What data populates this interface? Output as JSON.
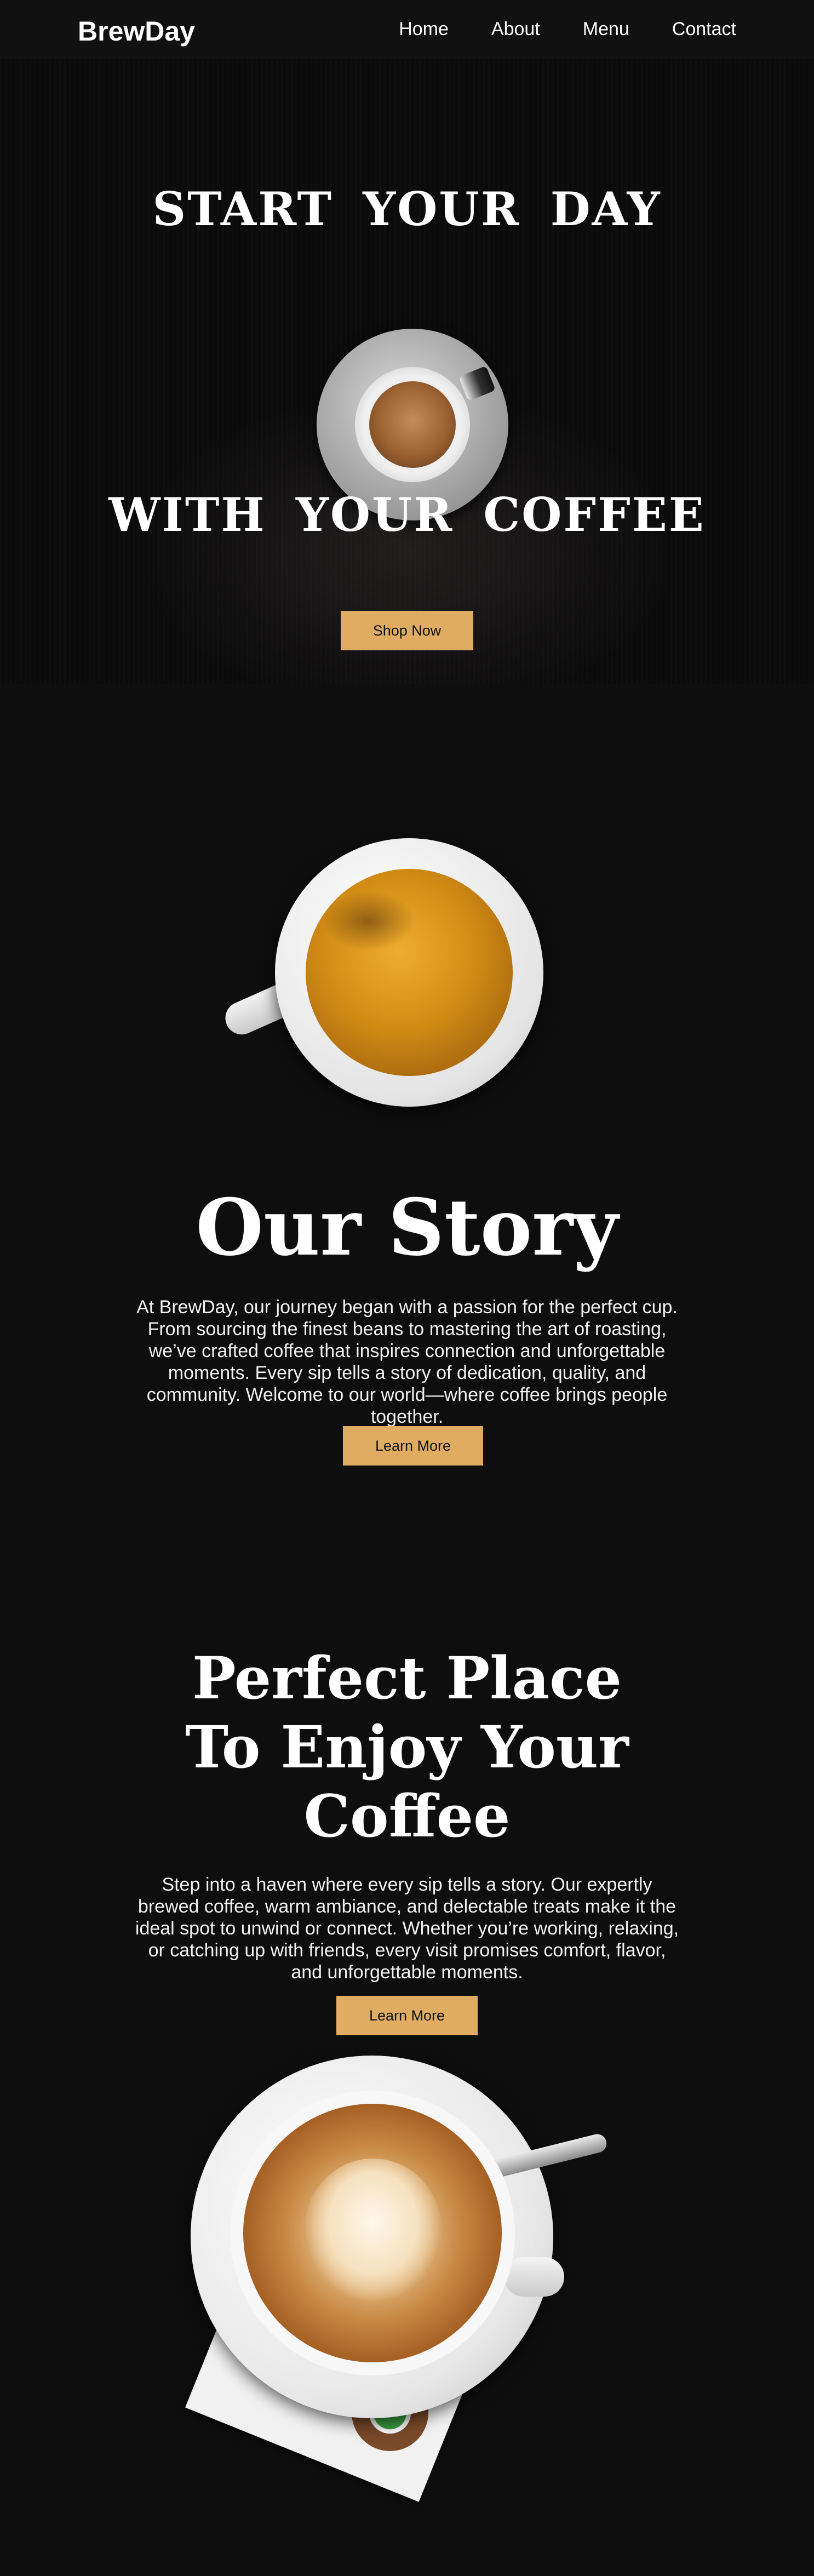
{
  "nav": {
    "brand": "BrewDay",
    "links": [
      "Home",
      "About",
      "Menu",
      "Contact"
    ]
  },
  "hero": {
    "line1": "START YOUR DAY",
    "line2": "WITH YOUR COFFEE",
    "button": "Shop Now"
  },
  "story": {
    "title": "Our Story",
    "text": "At BrewDay, our journey began with a passion for the perfect cup. From sourcing the finest beans to mastering the art of roasting, we’ve crafted coffee that inspires connection and unforgettable moments. Every sip tells a story of dedication, quality, and community. Welcome to our world—where coffee brings people together.",
    "button": "Learn More"
  },
  "place": {
    "title_lines": [
      "Perfect Place",
      "To Enjoy Your",
      "Coffee"
    ],
    "text": "Step into a haven where every sip tells a story. Our expertly brewed coffee, warm ambiance, and delectable treats make it the ideal spot to unwind or connect. Whether you’re working, relaxing, or catching up with friends, every visit promises comfort, flavor, and unforgettable moments.",
    "button": "Learn More"
  },
  "colors": {
    "background": "#0f0e0f",
    "accent": "#dfac62"
  }
}
